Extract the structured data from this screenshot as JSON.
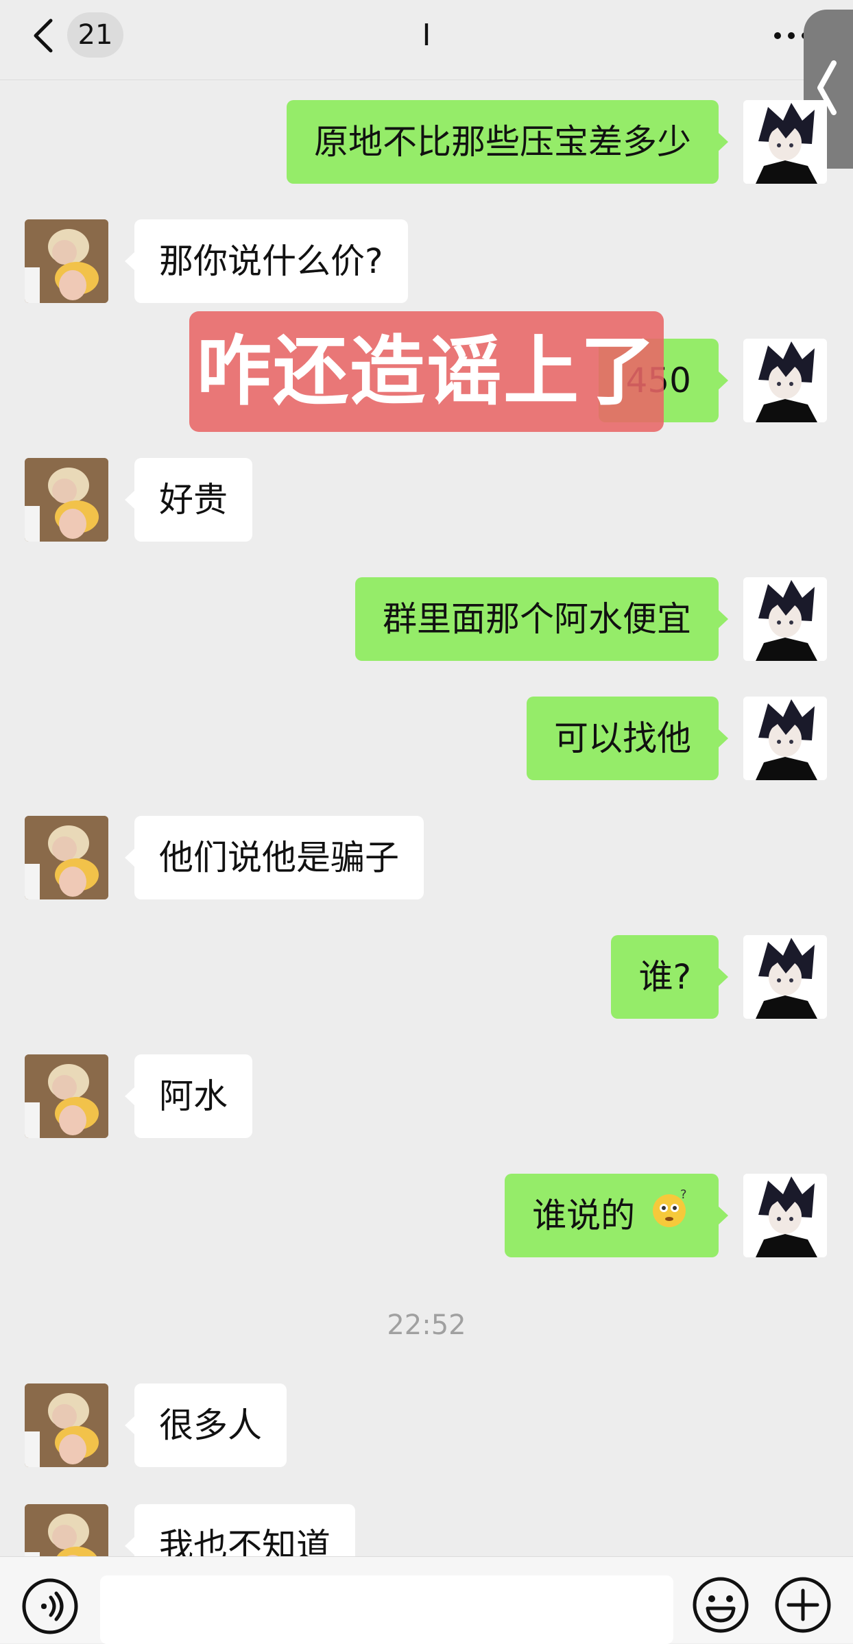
{
  "header": {
    "back_count": "21",
    "title": "I"
  },
  "messages": [
    {
      "side": "out",
      "text": "原地不比那些压宝差多少"
    },
    {
      "side": "in",
      "text": "那你说什么价?"
    },
    {
      "side": "out",
      "text": "450"
    },
    {
      "side": "in",
      "text": "好贵"
    },
    {
      "side": "out",
      "text": "群里面那个阿水便宜"
    },
    {
      "side": "out",
      "text": "可以找他"
    },
    {
      "side": "in",
      "text": "他们说他是骗子"
    },
    {
      "side": "out",
      "text": "谁?"
    },
    {
      "side": "in",
      "text": "阿水"
    },
    {
      "side": "out",
      "text": "谁说的",
      "emoji": "confused-face-emoji"
    },
    {
      "side": "in",
      "text": "很多人"
    },
    {
      "side": "in",
      "text": "我也不知道"
    }
  ],
  "timestamp": "22:52",
  "overlay_caption": "咋还造谣上了",
  "colors": {
    "outgoing_bubble": "#95ec69",
    "incoming_bubble": "#ffffff",
    "background": "#ededed",
    "overlay": "#e86767"
  },
  "icons": [
    "back-arrow-icon",
    "more-icon",
    "side-tab-chevron-icon",
    "voice-icon",
    "emoji-icon",
    "plus-icon"
  ]
}
